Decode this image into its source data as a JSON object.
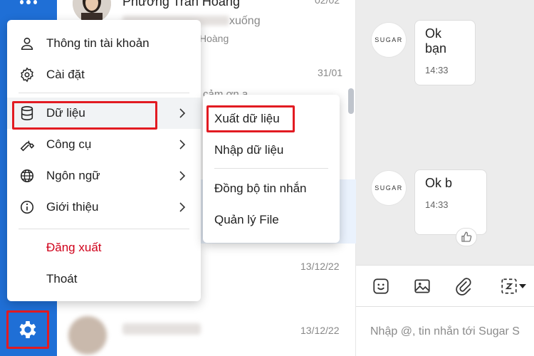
{
  "conversations": [
    {
      "name": "Phương Trần Hoàng",
      "snippet": "xuống",
      "sub": "Hoàng",
      "time": "02/02"
    },
    {
      "time": "31/01",
      "snippet": "cảm ơn a"
    },
    {
      "time": "13/12/22"
    },
    {
      "time": "13/12/22"
    }
  ],
  "menu": {
    "items": [
      {
        "label": "Thông tin tài khoản",
        "icon": "user-icon"
      },
      {
        "label": "Cài đặt",
        "icon": "gear-icon"
      },
      {
        "label": "Dữ liệu",
        "icon": "database-icon"
      },
      {
        "label": "Công cụ",
        "icon": "wrench-icon"
      },
      {
        "label": "Ngôn ngữ",
        "icon": "globe-icon"
      },
      {
        "label": "Giới thiệu",
        "icon": "info-icon"
      }
    ],
    "logout": "Đăng xuất",
    "exit": "Thoát"
  },
  "submenu": {
    "items": [
      "Xuất dữ liệu",
      "Nhập dữ liệu",
      "Đồng bộ tin nhắn",
      "Quản lý File"
    ]
  },
  "chat": {
    "bot_avatar": "SUGAR",
    "messages": [
      {
        "text": "Ok bạn",
        "time": "14:33"
      },
      {
        "text": "Ok b",
        "time": "14:33"
      }
    ],
    "compose_placeholder": "Nhập @, tin nhắn tới Sugar S"
  },
  "colors": {
    "rail_blue": "#1f6fd6",
    "highlight_red": "#e21b22",
    "logout_red": "#d0021b"
  }
}
